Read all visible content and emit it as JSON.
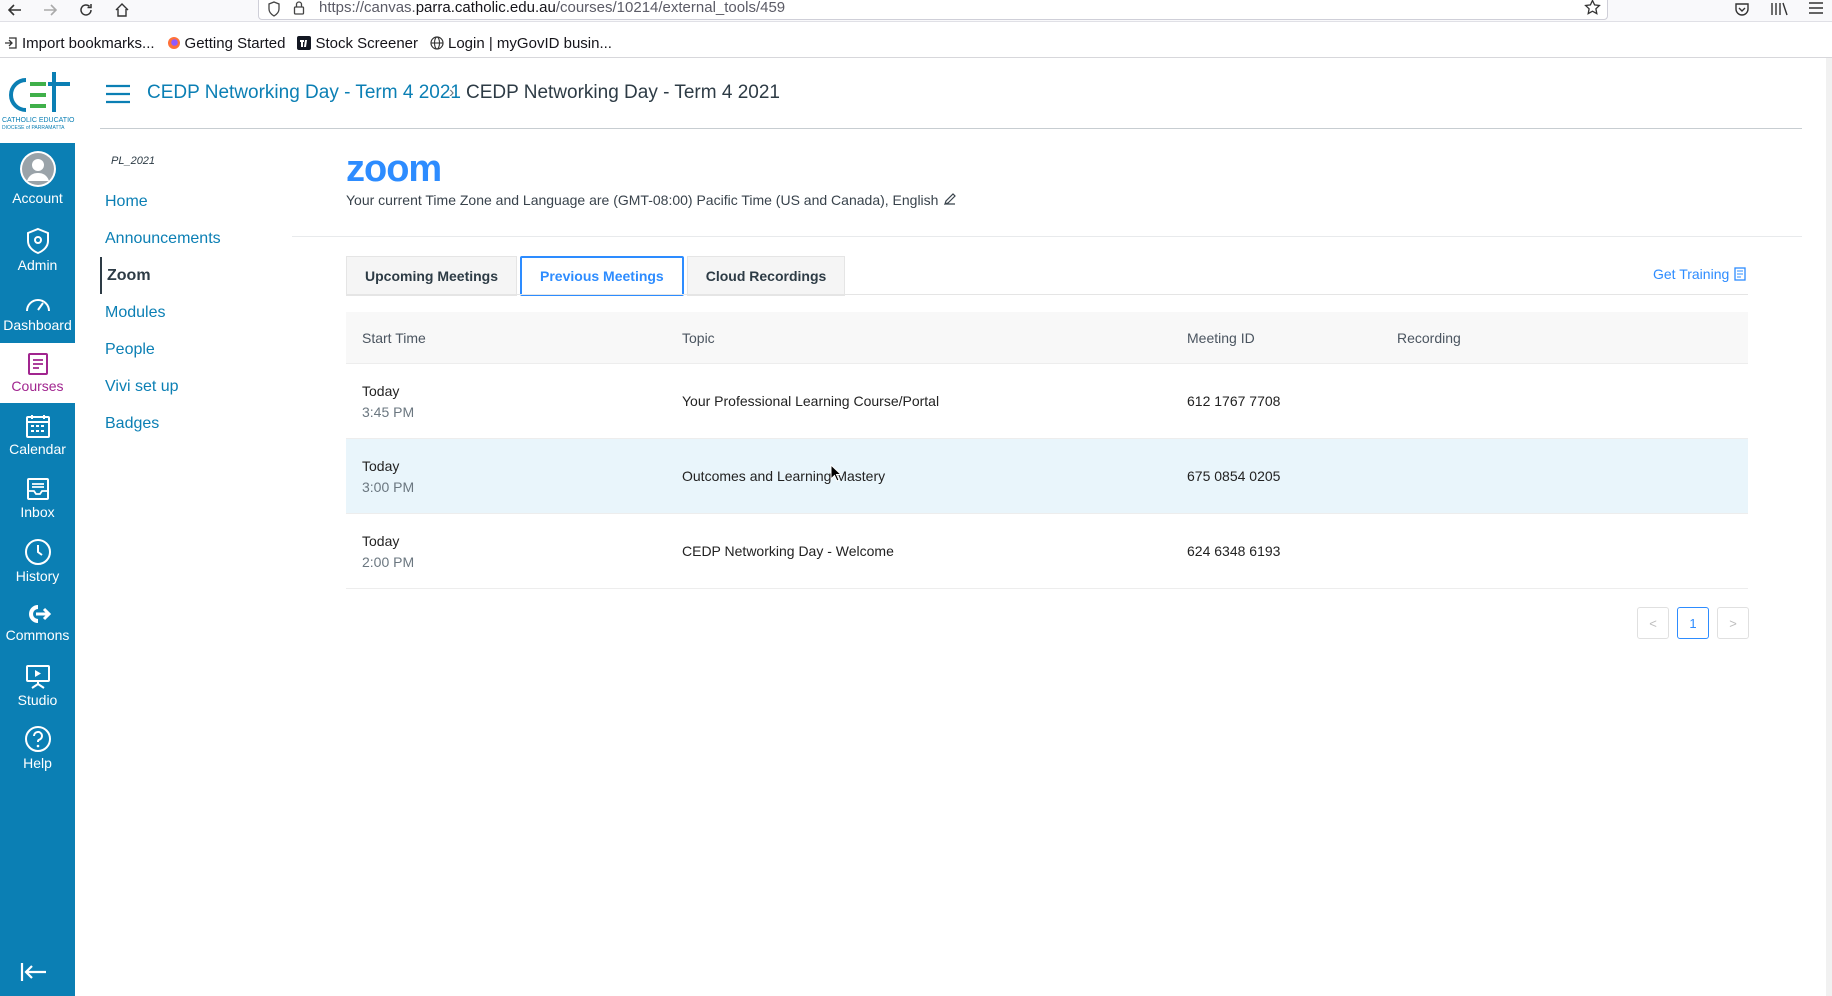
{
  "browser": {
    "url_prefix": "https://canvas.",
    "url_domain": "parra.catholic.edu.au",
    "url_path": "/courses/10214/external_tools/459",
    "bookmarks": [
      {
        "label": "Import bookmarks...",
        "icon": "import-icon"
      },
      {
        "label": "Getting Started",
        "icon": "firefox-icon"
      },
      {
        "label": "Stock Screener",
        "icon": "tradingview-icon"
      },
      {
        "label": "Login | myGovID busin...",
        "icon": "globe-icon"
      }
    ]
  },
  "global_nav": {
    "items": [
      {
        "label": "Account",
        "icon": "avatar-icon"
      },
      {
        "label": "Admin",
        "icon": "shield-icon"
      },
      {
        "label": "Dashboard",
        "icon": "dashboard-icon"
      },
      {
        "label": "Courses",
        "icon": "book-icon"
      },
      {
        "label": "Calendar",
        "icon": "calendar-icon"
      },
      {
        "label": "Inbox",
        "icon": "inbox-icon"
      },
      {
        "label": "History",
        "icon": "clock-icon"
      },
      {
        "label": "Commons",
        "icon": "commons-icon"
      },
      {
        "label": "Studio",
        "icon": "studio-icon"
      },
      {
        "label": "Help",
        "icon": "help-icon"
      }
    ],
    "active": "Courses",
    "color": "#0b7fb4",
    "active_color": "#a1258f"
  },
  "header": {
    "breadcrumb_link": "CEDP Networking Day - Term 4 2021",
    "breadcrumb_current": "CEDP Networking Day - Term 4 2021"
  },
  "course_nav": {
    "course_code": "PL_2021",
    "items": [
      "Home",
      "Announcements",
      "Zoom",
      "Modules",
      "People",
      "Vivi set up",
      "Badges"
    ],
    "active": "Zoom"
  },
  "zoom": {
    "logo": "zoom",
    "timezone_text": "Your current Time Zone and Language are (GMT-08:00) Pacific Time (US and Canada), English",
    "tabs": [
      "Upcoming Meetings",
      "Previous Meetings",
      "Cloud Recordings"
    ],
    "active_tab": "Previous Meetings",
    "get_training": "Get Training",
    "columns": [
      "Start Time",
      "Topic",
      "Meeting ID",
      "Recording"
    ],
    "rows": [
      {
        "day": "Today",
        "time": "3:45 PM",
        "topic": "Your Professional Learning Course/Portal",
        "meeting_id": "612 1767 7708",
        "recording": ""
      },
      {
        "day": "Today",
        "time": "3:00 PM",
        "topic": "Outcomes and Learning Mastery",
        "meeting_id": "675 0854 0205",
        "recording": ""
      },
      {
        "day": "Today",
        "time": "2:00 PM",
        "topic": "CEDP Networking Day - Welcome",
        "meeting_id": "624 6348 6193",
        "recording": ""
      }
    ],
    "pagination": {
      "prev": "<",
      "current": "1",
      "next": ">"
    },
    "accent": "#2d8cff"
  }
}
